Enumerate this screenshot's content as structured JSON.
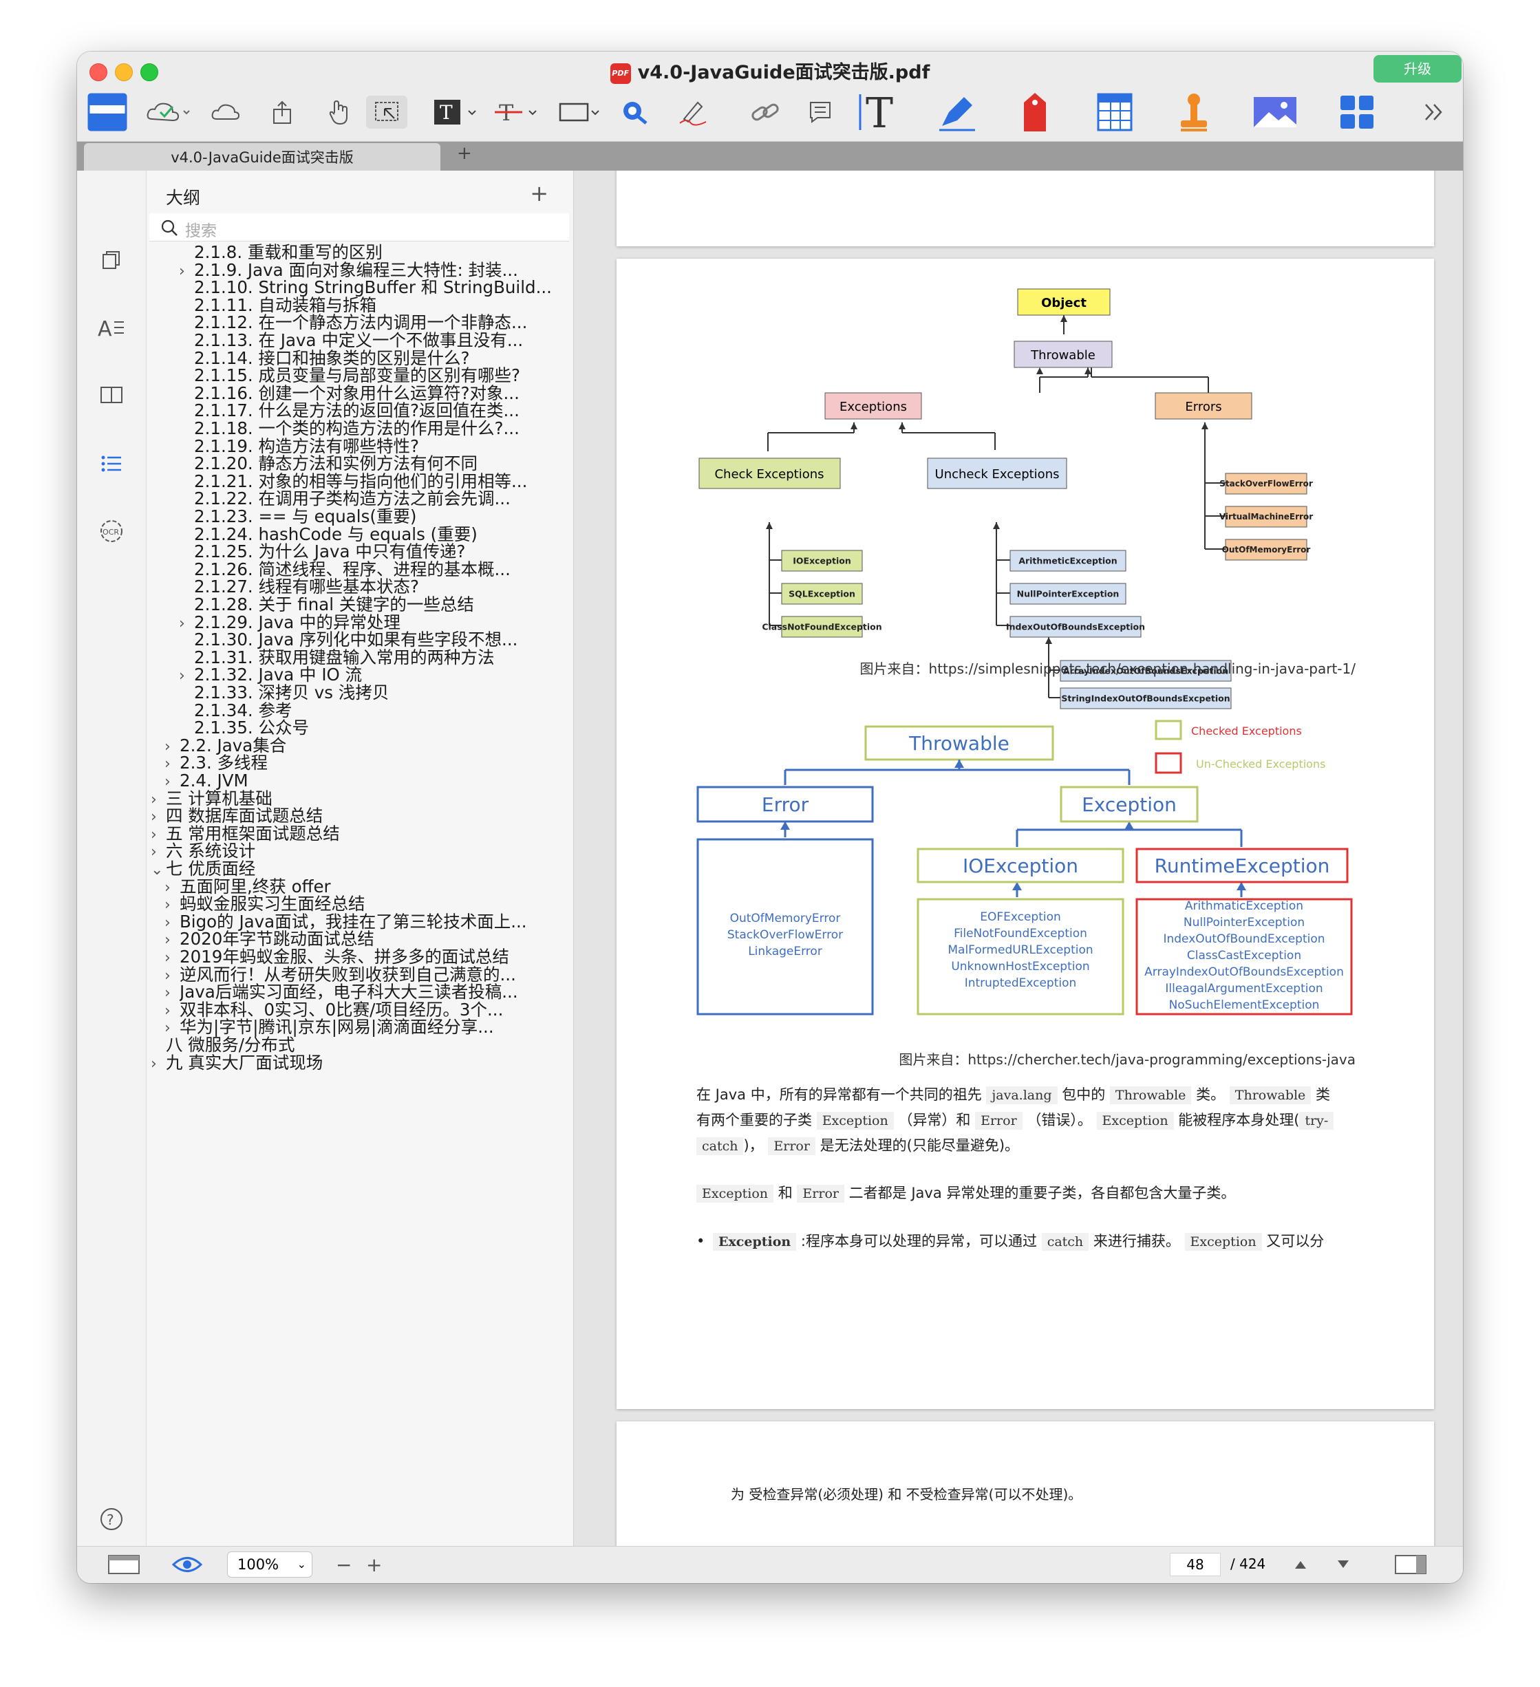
{
  "window": {
    "title": "v4.0-JavaGuide面试突击版.pdf",
    "upgrade_label": "升级"
  },
  "tabs": {
    "active": "v4.0-JavaGuide面试突击版",
    "add": "+"
  },
  "sidebar": {
    "title": "大纲",
    "add": "+",
    "search_placeholder": "搜索",
    "items": [
      {
        "label": "2.1.8. 重载和重写的区别",
        "level": 3,
        "expandable": false
      },
      {
        "label": "2.1.9. Java 面向对象编程三大特性: 封装...",
        "level": 3,
        "expandable": true
      },
      {
        "label": "2.1.10. String StringBuffer 和 StringBuild...",
        "level": 3,
        "expandable": false
      },
      {
        "label": "2.1.11. 自动装箱与拆箱",
        "level": 3,
        "expandable": false
      },
      {
        "label": "2.1.12. 在一个静态方法内调用一个非静态...",
        "level": 3,
        "expandable": false
      },
      {
        "label": "2.1.13. 在 Java 中定义一个不做事且没有...",
        "level": 3,
        "expandable": false
      },
      {
        "label": "2.1.14. 接口和抽象类的区别是什么?",
        "level": 3,
        "expandable": false
      },
      {
        "label": "2.1.15. 成员变量与局部变量的区别有哪些?",
        "level": 3,
        "expandable": false
      },
      {
        "label": "2.1.16. 创建一个对象用什么运算符?对象...",
        "level": 3,
        "expandable": false
      },
      {
        "label": "2.1.17. 什么是方法的返回值?返回值在类...",
        "level": 3,
        "expandable": false
      },
      {
        "label": "2.1.18. 一个类的构造方法的作用是什么?...",
        "level": 3,
        "expandable": false
      },
      {
        "label": "2.1.19. 构造方法有哪些特性?",
        "level": 3,
        "expandable": false
      },
      {
        "label": "2.1.20. 静态方法和实例方法有何不同",
        "level": 3,
        "expandable": false
      },
      {
        "label": "2.1.21. 对象的相等与指向他们的引用相等...",
        "level": 3,
        "expandable": false
      },
      {
        "label": "2.1.22. 在调用子类构造方法之前会先调...",
        "level": 3,
        "expandable": false
      },
      {
        "label": "2.1.23. == 与 equals(重要)",
        "level": 3,
        "expandable": false
      },
      {
        "label": "2.1.24. hashCode 与 equals (重要)",
        "level": 3,
        "expandable": false
      },
      {
        "label": "2.1.25. 为什么 Java 中只有值传递?",
        "level": 3,
        "expandable": false
      },
      {
        "label": "2.1.26. 简述线程、程序、进程的基本概...",
        "level": 3,
        "expandable": false
      },
      {
        "label": "2.1.27. 线程有哪些基本状态?",
        "level": 3,
        "expandable": false
      },
      {
        "label": "2.1.28. 关于 final 关键字的一些总结",
        "level": 3,
        "expandable": false
      },
      {
        "label": "2.1.29. Java 中的异常处理",
        "level": 3,
        "expandable": true
      },
      {
        "label": "2.1.30. Java 序列化中如果有些字段不想...",
        "level": 3,
        "expandable": false
      },
      {
        "label": "2.1.31. 获取用键盘输入常用的两种方法",
        "level": 3,
        "expandable": false
      },
      {
        "label": "2.1.32. Java 中 IO 流",
        "level": 3,
        "expandable": true
      },
      {
        "label": "2.1.33. 深拷贝 vs 浅拷贝",
        "level": 3,
        "expandable": false
      },
      {
        "label": "2.1.34. 参考",
        "level": 3,
        "expandable": false
      },
      {
        "label": "2.1.35. 公众号",
        "level": 3,
        "expandable": false
      },
      {
        "label": "2.2. Java集合",
        "level": 2,
        "expandable": true
      },
      {
        "label": "2.3. 多线程",
        "level": 2,
        "expandable": true
      },
      {
        "label": "2.4. JVM",
        "level": 2,
        "expandable": true
      },
      {
        "label": "三 计算机基础",
        "level": 1,
        "expandable": true
      },
      {
        "label": "四 数据库面试题总结",
        "level": 1,
        "expandable": true
      },
      {
        "label": "五 常用框架面试题总结",
        "level": 1,
        "expandable": true
      },
      {
        "label": "六 系统设计",
        "level": 1,
        "expandable": true
      },
      {
        "label": "七 优质面经",
        "level": 1,
        "expandable": true,
        "expanded": true
      },
      {
        "label": "五面阿里,终获 offer",
        "level": 2,
        "expandable": true
      },
      {
        "label": "蚂蚁金服实习生面经总结",
        "level": 2,
        "expandable": true
      },
      {
        "label": "Bigo的 Java面试，我挂在了第三轮技术面上...",
        "level": 2,
        "expandable": true
      },
      {
        "label": "2020年字节跳动面试总结",
        "level": 2,
        "expandable": true
      },
      {
        "label": "2019年蚂蚁金服、头条、拼多多的面试总结",
        "level": 2,
        "expandable": true
      },
      {
        "label": "逆风而行！从考研失败到收获到自己满意的...",
        "level": 2,
        "expandable": true
      },
      {
        "label": "Java后端实习面经，电子科大大三读者投稿...",
        "level": 2,
        "expandable": true
      },
      {
        "label": "双非本科、0实习、0比赛/项目经历。3个...",
        "level": 2,
        "expandable": true
      },
      {
        "label": "华为|字节|腾讯|京东|网易|滴滴面经分享...",
        "level": 2,
        "expandable": true
      },
      {
        "label": "八 微服务/分布式",
        "level": 1,
        "expandable": false
      },
      {
        "label": "九 真实大厂面试现场",
        "level": 1,
        "expandable": true
      }
    ]
  },
  "diagram1": {
    "root": "Object",
    "throwable": "Throwable",
    "exceptions": "Exceptions",
    "errors": "Errors",
    "check": "Check Exceptions",
    "uncheck": "Uncheck Exceptions",
    "check_items": [
      "IOException",
      "SQLException",
      "ClassNotFoundException"
    ],
    "uncheck_items": [
      "ArithmeticException",
      "NullPointerException",
      "IndexOutOfBoundsException"
    ],
    "index_children": [
      "ArrayIndexOutOfBoundsExcpetion",
      "StringIndexOutOfBoundsExcpetion"
    ],
    "error_items": [
      "StackOverFlowError",
      "VirtualMachineError",
      "OutOfMemoryError"
    ],
    "caption": "图片来自：https://simplesnippets.tech/exception-handling-in-java-part-1/"
  },
  "diagram2": {
    "throwable": "Throwable",
    "error": "Error",
    "exception": "Exception",
    "ioexception": "IOException",
    "runtime": "RuntimeException",
    "legend_checked": "Checked Exceptions",
    "legend_unchecked": "Un-Checked Exceptions",
    "error_items": [
      "OutOfMemoryError",
      "StackOverFlowError",
      "LinkageError"
    ],
    "io_items": [
      "EOFException",
      "FileNotFoundException",
      "MalFormedURLException",
      "UnknownHostException",
      "IntruptedException"
    ],
    "runtime_items": [
      "ArithmaticException",
      "NullPointerException",
      "IndexOutOfBoundException",
      "ClassCastException",
      "ArrayIndexOutOfBoundsException",
      "IlleagalArgumentException",
      "NoSuchElementException"
    ],
    "caption": "图片来自：https://chercher.tech/java-programming/exceptions-java"
  },
  "text": {
    "p1_a": "在 Java 中，所有的异常都有一个共同的祖先",
    "p1_code1": "java.lang",
    "p1_b": "包中的",
    "p1_code2": "Throwable",
    "p1_c": "类。",
    "p1_code3": "Throwable",
    "p1_d": "类",
    "p2_a": "有两个重要的子类",
    "p2_code1": "Exception",
    "p2_b": "（异常）和",
    "p2_code2": "Error",
    "p2_c": "（错误）。",
    "p2_code3": "Exception",
    "p2_d": "能被程序本身处理(",
    "p2_code4": "try-",
    "p3_code1": "catch",
    "p3_a": ")，",
    "p3_code2": "Error",
    "p3_b": "是无法处理的(只能尽量避免)。",
    "p4_code1": "Exception",
    "p4_a": "和",
    "p4_code2": "Error",
    "p4_b": "二者都是 Java 异常处理的重要子类，各自都包含大量子类。",
    "p5_code1": "Exception",
    "p5_a": ":程序本身可以处理的异常，可以通过",
    "p5_code2": "catch",
    "p5_b": "来进行捕获。",
    "p5_code3": "Exception",
    "p5_c": "又可以分",
    "next_page_text": "为 受检查异常(必须处理) 和 不受检查异常(可以不处理)。"
  },
  "bottom": {
    "zoom": "100%",
    "page": "48",
    "total": "/ 424",
    "minus": "−",
    "plus": "+"
  },
  "colors": {
    "upgrade": "#4cc27b",
    "accent": "#2b6fe0"
  }
}
